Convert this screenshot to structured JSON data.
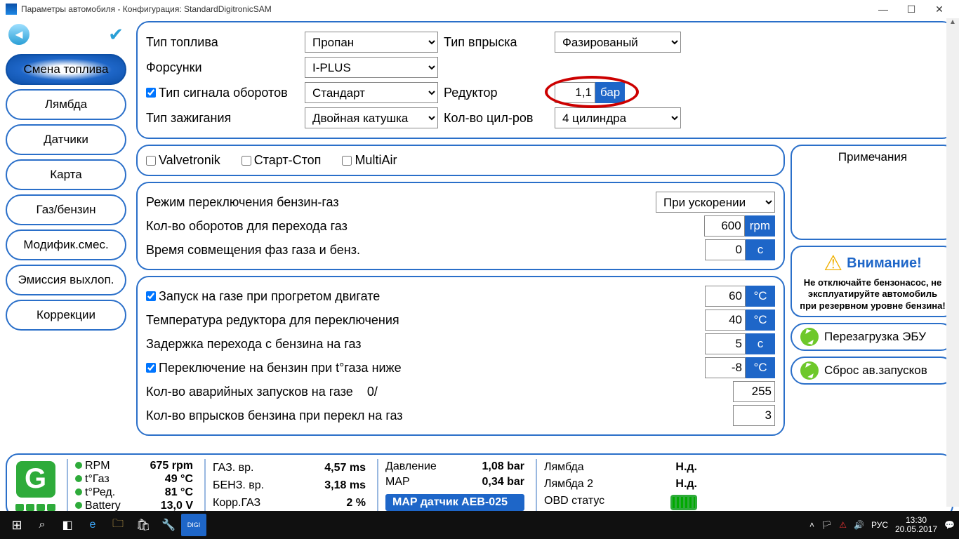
{
  "window": {
    "title": "Параметры автомобиля - Конфигурация: StandardDigitronicSAM"
  },
  "sidebar": {
    "items": [
      "Смена топлива",
      "Лямбда",
      "Датчики",
      "Карта",
      "Газ/бензин",
      "Модифик.смес.",
      "Эмиссия выхлоп.",
      "Коррекции"
    ]
  },
  "top_panel": {
    "fuel_type_lbl": "Тип топлива",
    "fuel_type_val": "Пропан",
    "inject_type_lbl": "Тип впрыска",
    "inject_type_val": "Фазированый",
    "injectors_lbl": "Форсунки",
    "injectors_val": "I-PLUS",
    "rpm_signal_chk": "Тип сигнала оборотов",
    "rpm_signal_val": "Стандарт",
    "reducer_lbl": "Редуктор",
    "reducer_val": "1,1",
    "reducer_unit": "бар",
    "ignition_lbl": "Тип зажигания",
    "ignition_val": "Двойная катушка",
    "cyl_lbl": "Кол-во цил-ров",
    "cyl_val": "4 цилиндра"
  },
  "checks": {
    "valvetronik": "Valvetronik",
    "start_stop": "Старт-Стоп",
    "multiair": "MultiAir"
  },
  "switch_panel": {
    "mode_lbl": "Режим переключения бензин-газ",
    "mode_val": "При ускорении",
    "rpm_lbl": "Кол-во оборотов для перехода газ",
    "rpm_val": "600",
    "rpm_unit": "rpm",
    "overlap_lbl": "Время совмещения фаз газа и бенз.",
    "overlap_val": "0",
    "overlap_unit": "с"
  },
  "temp_panel": {
    "warm_start_chk": "Запуск на газе при прогретом двигате",
    "warm_start_val": "60",
    "deg_c": "°C",
    "reduc_temp_lbl": "Температура редуктора для переключения",
    "reduc_temp_val": "40",
    "delay_lbl": "Задержка перехода с бензина на газ",
    "delay_val": "5",
    "sec": "с",
    "back_chk": "Переключение на бензин при t°газа ниже",
    "back_val": "-8",
    "emerg_lbl": "Кол-во  аварийных запусков на газе",
    "emerg_cur": "0/",
    "emerg_val": "255",
    "inj_lbl": "Кол-во впрысков бензина при перекл на газ",
    "inj_val": "3"
  },
  "notes": {
    "title": "Примечания"
  },
  "warning": {
    "title": "Внимание!",
    "text": "Не отключайте бензонасос, не эксплуатируйте автомобиль при резервном уровне бензина!"
  },
  "actions": {
    "reboot": "Перезагрузка ЭБУ",
    "reset": "Сброс ав.запусков"
  },
  "status": {
    "rpm_lbl": "RPM",
    "rpm_val": "675 rpm",
    "tgas_lbl": "t°Газ",
    "tgas_val": "49 °C",
    "tred_lbl": "t°Ред.",
    "tred_val": "81 °C",
    "batt_lbl": "Battery",
    "batt_val": "13,0 V",
    "gas_time_lbl": "ГАЗ. вр.",
    "gas_time_val": "4,57 ms",
    "benz_time_lbl": "БЕНЗ. вр.",
    "benz_time_val": "3,18 ms",
    "corr_lbl": "Корр.ГАЗ",
    "corr_val": "2 %",
    "press_lbl": "Давление",
    "press_val": "1,08 bar",
    "map_lbl": "MAP",
    "map_val": "0,34 bar",
    "map_sensor": "MAP датчик AEB-025",
    "lambda_lbl": "Лямбда",
    "lambda_val": "Н.д.",
    "lambda2_lbl": "Лямбда 2",
    "lambda2_val": "Н.д.",
    "obd_lbl": "OBD статус"
  },
  "taskbar": {
    "lang": "РУС",
    "time": "13:30",
    "date": "20.05.2017"
  }
}
